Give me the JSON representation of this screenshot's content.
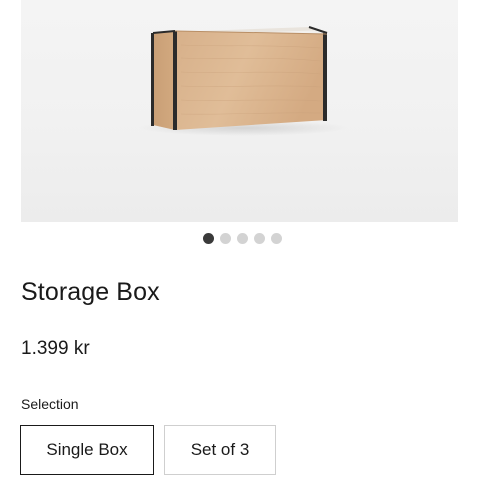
{
  "product": {
    "image_icon": "wooden-storage-box-photo",
    "carousel_dots": [
      {
        "active": true
      },
      {
        "active": false
      },
      {
        "active": false
      },
      {
        "active": false
      },
      {
        "active": false
      }
    ],
    "title": "Storage Box",
    "price": "1.399 kr",
    "selection_label": "Selection",
    "options": [
      {
        "label": "Single Box",
        "selected": true
      },
      {
        "label": "Set of 3",
        "selected": false
      }
    ]
  },
  "colors": {
    "text": "#1a1a1a",
    "dot_active": "#3a3a3a",
    "dot_inactive": "#d3d3d3",
    "image_background": "#f1f1f1",
    "wood": "#d9b48c"
  }
}
